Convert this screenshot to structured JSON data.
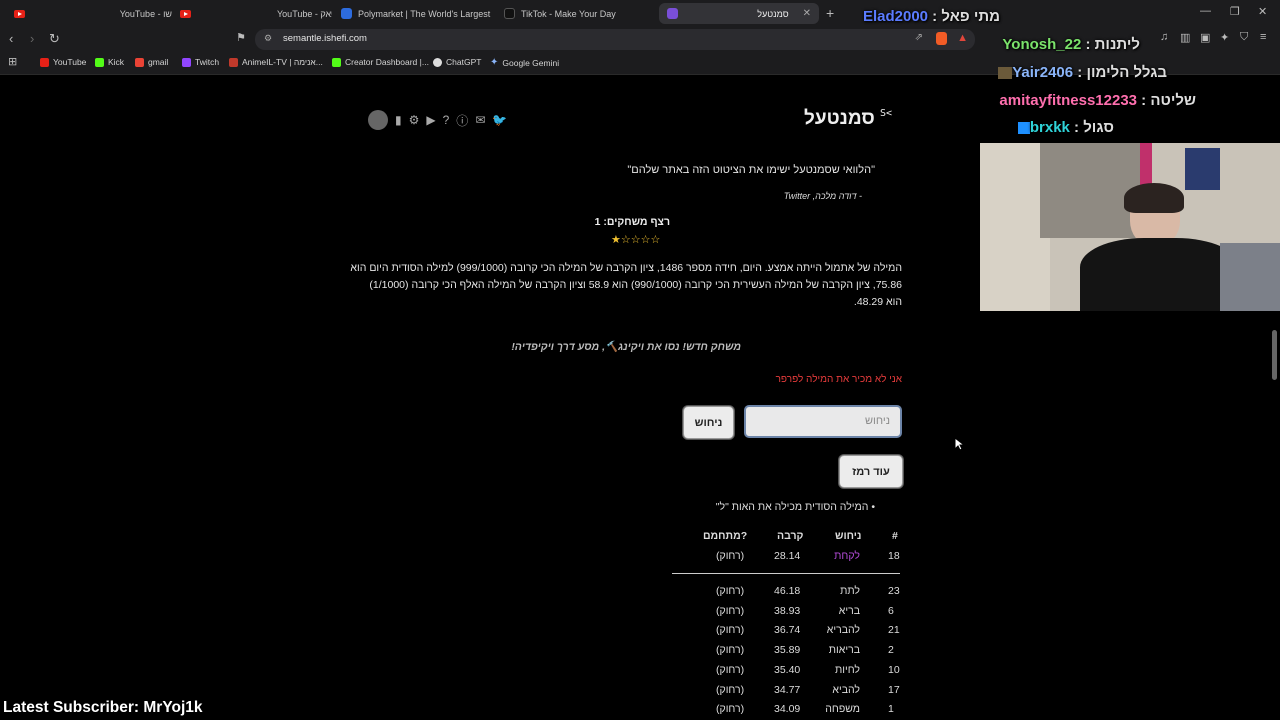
{
  "browser": {
    "tabs": [
      {
        "title": "YouTube - שו",
        "active": false
      },
      {
        "title": "YouTube - פאק",
        "active": false
      },
      {
        "title": "Polymarket | The World's Largest Pre",
        "active": false
      },
      {
        "title": "TikTok - Make Your Day",
        "active": false
      },
      {
        "title": "סמנטעל",
        "active": true
      }
    ],
    "url": "semantle.ishefi.com",
    "bookmarks": [
      "YouTube",
      "Kick",
      "gmail",
      "Twitch",
      "AnimeIL-TV | אנימה...",
      "Creator Dashboard |...",
      "ChatGPT",
      "Google Gemini"
    ]
  },
  "page": {
    "logo_text": "S<",
    "title": "סמנטעל",
    "quote": "\"הלוואי שסמנטעל ישימו את הציטוט הזה באתר שלהם\"",
    "quote_author_prefix": "- דודה מלכה, ",
    "quote_author_source": "Twitter",
    "streak_label": "רצף משחקים: 1",
    "stars": "★☆☆☆☆",
    "summary_line1": "המילה של אתמול הייתה אמצע. היום, חידה מספר 1486, ציון הקרבה של המילה הכי קרובה (999/1000) למילה הסודית היום הוא",
    "summary_line2": "75.86, ציון הקרבה של המילה העשירית הכי קרובה (990/1000) הוא 58.9 וציון הקרבה של המילה האלף הכי קרובה (1/1000)",
    "summary_line3": "הוא 48.29.",
    "new_game": "משחק חדש! נסו את ויקינג🔨, מסע דרך ויקיפדיה!",
    "error": "אני לא מכיר את המילה לפרפר",
    "input_placeholder": "ניחוש",
    "guess_button": "ניחוש",
    "hint_button": "עוד רמז",
    "hint_text": "המילה הסודית מכילה את האות \"ל\"",
    "columns": [
      "#",
      "ניחוש",
      "קרבה",
      "מתחמם?"
    ],
    "last_guess": {
      "num": "18",
      "word": "לקחת",
      "score": "28.14",
      "status": "(רחוק)"
    },
    "guesses": [
      {
        "num": "23",
        "word": "לתת",
        "score": "46.18",
        "status": "(רחוק)"
      },
      {
        "num": "6",
        "word": "בריא",
        "score": "38.93",
        "status": "(רחוק)"
      },
      {
        "num": "21",
        "word": "להבריא",
        "score": "36.74",
        "status": "(רחוק)"
      },
      {
        "num": "2",
        "word": "בריאות",
        "score": "35.89",
        "status": "(רחוק)"
      },
      {
        "num": "10",
        "word": "לחיות",
        "score": "35.40",
        "status": "(רחוק)"
      },
      {
        "num": "17",
        "word": "להביא",
        "score": "34.77",
        "status": "(רחוק)"
      },
      {
        "num": "1",
        "word": "משפחה",
        "score": "34.09",
        "status": "(רחוק)"
      }
    ]
  },
  "overlay": {
    "chat": [
      {
        "user": "Elad2000",
        "msg": "מתי פאל",
        "color": "#5b7cff"
      },
      {
        "user": "Yonosh_22",
        "msg": "ליתנות",
        "color": "#7be36b"
      },
      {
        "user": "Yair2406",
        "msg": "בגלל הלימון",
        "color": "#8ab4f8"
      },
      {
        "user": "amitayfitness12233",
        "msg": "שליטה",
        "color": "#ff6fae"
      },
      {
        "user": "brxkk",
        "msg": "סגול",
        "color": "#2fd3d8"
      }
    ],
    "latest_subscriber": "Latest Subscriber: MrYoj1k"
  },
  "colors": {
    "accent_link": "#b24bd6",
    "error": "#e53b3b",
    "input_border": "#6c84a8"
  }
}
